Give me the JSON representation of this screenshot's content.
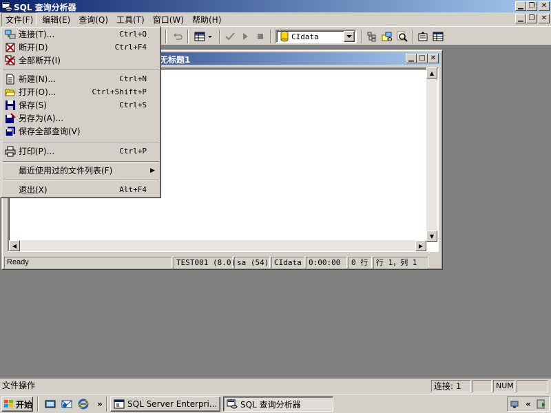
{
  "app": {
    "title": "SQL 查询分析器"
  },
  "menubar": {
    "items": [
      "文件(F)",
      "编辑(E)",
      "查询(Q)",
      "工具(T)",
      "窗口(W)",
      "帮助(H)"
    ]
  },
  "toolbar": {
    "database": "CIdata",
    "icons": [
      "new-query-icon",
      "open-icon",
      "save-icon",
      "undo-icon",
      "grid-results-icon",
      "parse-check-icon",
      "execute-icon",
      "stop-icon",
      "object-browser-icon",
      "object-search-icon",
      "properties-icon",
      "table-icon"
    ]
  },
  "query_window": {
    "title": "无标题1",
    "status": [
      "Ready",
      "TEST001 (8.0)",
      "sa (54)",
      "CIdata",
      "0:00:00",
      "0 行",
      "行 1，列 1"
    ]
  },
  "file_menu": {
    "items": [
      {
        "label": "连接(T)...",
        "shortcut": "Ctrl+Q",
        "icon": "connect-icon"
      },
      {
        "label": "断开(D)",
        "shortcut": "Ctrl+F4",
        "icon": "disconnect-icon"
      },
      {
        "label": "全部断开(I)",
        "shortcut": "",
        "icon": "disconnect-all-icon"
      },
      {
        "label": "新建(N)...",
        "shortcut": "Ctrl+N",
        "icon": "new-icon"
      },
      {
        "label": "打开(O)...",
        "shortcut": "Ctrl+Shift+P",
        "icon": "open-folder-icon"
      },
      {
        "label": "保存(S)",
        "shortcut": "Ctrl+S",
        "icon": "save-icon"
      },
      {
        "label": "另存为(A)...",
        "shortcut": "",
        "icon": "save-as-icon"
      },
      {
        "label": "保存全部查询(V)",
        "shortcut": "",
        "icon": "save-all-icon"
      },
      {
        "label": "打印(P)...",
        "shortcut": "Ctrl+P",
        "icon": "print-icon"
      },
      {
        "label": "最近使用过的文件列表(F)",
        "shortcut": "",
        "icon": ""
      },
      {
        "label": "退出(X)",
        "shortcut": "Alt+F4",
        "icon": ""
      }
    ]
  },
  "statusbar": {
    "text": "文件操作",
    "connections": "连接: 1",
    "num": "NUM"
  },
  "taskbar": {
    "start": "开始",
    "tasks": [
      "SQL Server Enterpri...",
      "SQL 查询分析器"
    ]
  }
}
